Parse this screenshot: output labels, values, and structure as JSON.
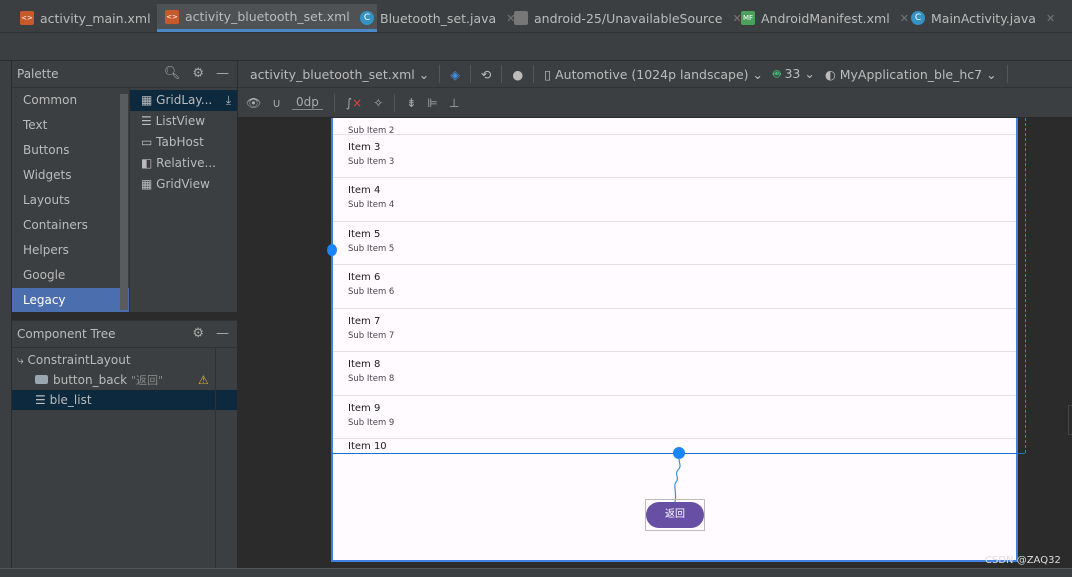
{
  "tabs": [
    {
      "label": "activity_main.xml",
      "icon": "xml-file-icon",
      "active": false
    },
    {
      "label": "activity_bluetooth_set.xml",
      "icon": "xml-file-icon",
      "active": true
    },
    {
      "label": "Bluetooth_set.java",
      "icon": "java-class-icon",
      "active": false
    },
    {
      "label": "android-25/UnavailableSource",
      "icon": "source-file-icon",
      "active": false
    },
    {
      "label": "AndroidManifest.xml",
      "icon": "manifest-file-icon",
      "active": false
    },
    {
      "label": "MainActivity.java",
      "icon": "java-class-icon",
      "active": false
    }
  ],
  "palette": {
    "title": "Palette",
    "categories": [
      "Common",
      "Text",
      "Buttons",
      "Widgets",
      "Layouts",
      "Containers",
      "Helpers",
      "Google",
      "Legacy"
    ],
    "selected_category": "Legacy",
    "widgets": [
      "GridLay...",
      "ListView",
      "TabHost",
      "Relative...",
      "GridView"
    ]
  },
  "component_tree": {
    "title": "Component Tree",
    "nodes": [
      {
        "label": "ConstraintLayout"
      },
      {
        "label": "button_back",
        "hint": "\"返回\"",
        "warning": true
      },
      {
        "label": "ble_list",
        "selected": true
      }
    ]
  },
  "toolbar": {
    "file": "activity_bluetooth_set.xml",
    "device": "Automotive (1024p landscape)",
    "api": "33",
    "theme": "MyApplication_ble_hc7",
    "margin": "0dp"
  },
  "preview": {
    "partial_top": "Sub Item 2",
    "items": [
      {
        "t": "Item 3",
        "s": "Sub Item 3"
      },
      {
        "t": "Item 4",
        "s": "Sub Item 4"
      },
      {
        "t": "Item 5",
        "s": "Sub Item 5"
      },
      {
        "t": "Item 6",
        "s": "Sub Item 6"
      },
      {
        "t": "Item 7",
        "s": "Sub Item 7"
      },
      {
        "t": "Item 8",
        "s": "Sub Item 8"
      },
      {
        "t": "Item 9",
        "s": "Sub Item 9"
      },
      {
        "t": "Item 10",
        "s": ""
      }
    ],
    "button": "返回"
  },
  "watermark": "CSDN @ZAQ32",
  "colors": {
    "accent": "#4a88c7",
    "button": "#6750a4",
    "constraint": "#1a85ff",
    "selection": "#4b6eaf"
  }
}
